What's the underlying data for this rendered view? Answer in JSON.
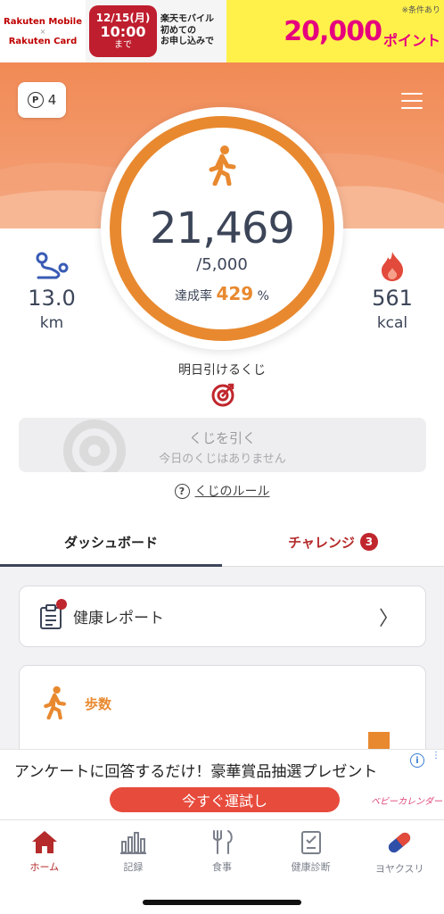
{
  "ad_top": {
    "brand_mobile": "Rakuten Mobile",
    "brand_x": "×",
    "brand_card": "Rakuten Card",
    "date": "12/15(月)",
    "time": "10:00",
    "until": "まで",
    "copy_line1": "楽天モバイル",
    "copy_line2": "初めての",
    "copy_line3": "お申し込みで",
    "amount": "20,000",
    "point_label": "ポイント",
    "condition": "※条件あり"
  },
  "header": {
    "points": "4",
    "points_symbol": "P"
  },
  "activity": {
    "steps": "21,469",
    "goal": "/5,000",
    "rate_label": "達成率",
    "rate_value": "429",
    "rate_unit": "%",
    "distance_value": "13.0",
    "distance_unit": "km",
    "calories_value": "561",
    "calories_unit": "kcal",
    "goal_progress": 4.29
  },
  "lottery": {
    "tomorrow_label": "明日引けるくじ",
    "button_label": "くじを引く",
    "button_sub": "今日のくじはありません",
    "rules_link": "くじのルール",
    "rules_symbol": "?"
  },
  "tabs": {
    "dashboard": "ダッシュボード",
    "challenge": "チャレンジ",
    "challenge_count": "3"
  },
  "dashboard": {
    "report_label": "健康レポート",
    "report_chevron": "〉",
    "steps_title": "歩数"
  },
  "ad_bottom": {
    "headline": "アンケートに回答するだけ！豪華賞品抽選プレゼント",
    "cta": "今すぐ運試し",
    "sponsor": "ベビーカレンダー",
    "info": "i",
    "more": "⋮"
  },
  "nav": {
    "home": "ホーム",
    "records": "記録",
    "meals": "食事",
    "checkup": "健康診断",
    "medicine": "ヨヤクスリ"
  },
  "colors": {
    "accent": "#e8892f",
    "hero_top": "#f18a55",
    "nav_active": "#b52a2a",
    "text_dark": "#3c4558"
  }
}
